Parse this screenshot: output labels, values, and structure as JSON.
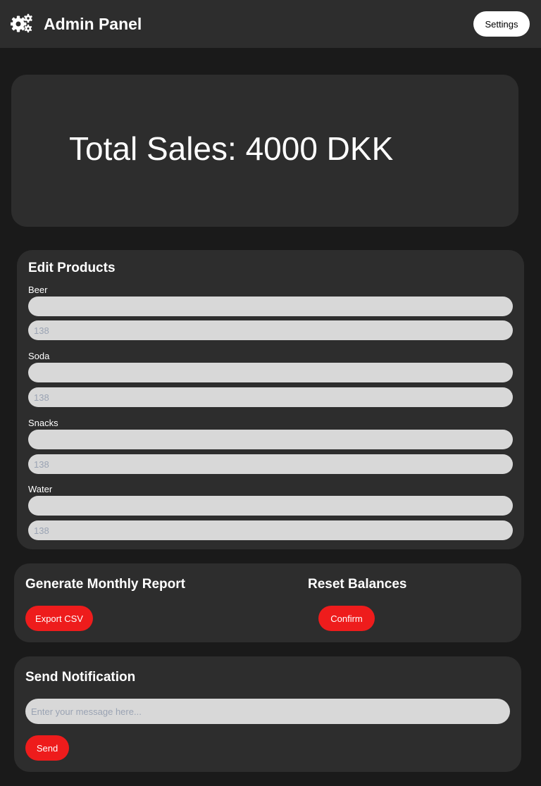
{
  "header": {
    "icon": "gears-icon",
    "title": "Admin Panel",
    "settings_label": "Settings"
  },
  "sales": {
    "text": "Total Sales: 4000 DKK"
  },
  "products": {
    "heading": "Edit Products",
    "items": [
      {
        "label": "Beer",
        "name_value": "",
        "price_placeholder": "138"
      },
      {
        "label": "Soda",
        "name_value": "",
        "price_placeholder": "138"
      },
      {
        "label": "Snacks",
        "name_value": "",
        "price_placeholder": "138"
      },
      {
        "label": "Water",
        "name_value": "",
        "price_placeholder": "138"
      }
    ]
  },
  "report": {
    "heading": "Generate Monthly Report",
    "button_label": "Export CSV"
  },
  "reset": {
    "heading": "Reset Balances",
    "button_label": "Confirm"
  },
  "notification": {
    "heading": "Send Notification",
    "placeholder": "Enter your message here...",
    "button_label": "Send"
  },
  "colors": {
    "background": "#1a1a1a",
    "card": "#2d2d2d",
    "accent": "#ee1c1c",
    "input": "#d8d8d8"
  }
}
